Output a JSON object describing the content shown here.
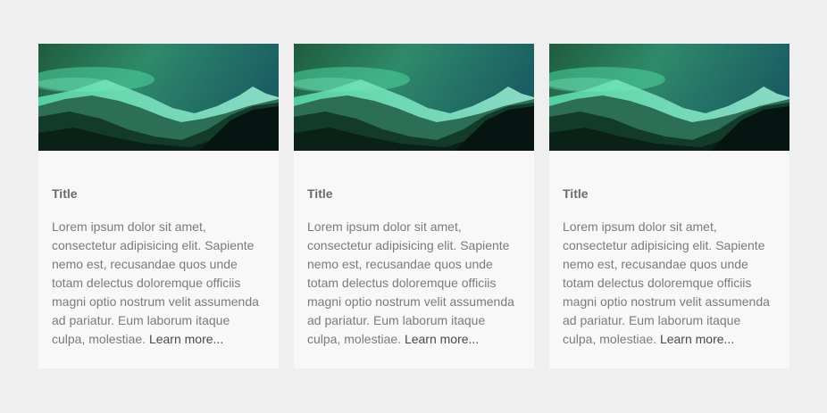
{
  "cards": [
    {
      "image": "mountain-landscape-image",
      "title": "Title",
      "body": "Lorem ipsum dolor sit amet, consectetur adipisicing elit. Sapiente nemo est, recusandae quos unde totam delectus doloremque officiis magni optio nostrum velit assumenda ad pariatur. Eum laborum itaque culpa, molestiae.",
      "link_label": "Learn more..."
    },
    {
      "image": "mountain-landscape-image",
      "title": "Title",
      "body": "Lorem ipsum dolor sit amet, consectetur adipisicing elit. Sapiente nemo est, recusandae quos unde totam delectus doloremque officiis magni optio nostrum velit assumenda ad pariatur. Eum laborum itaque culpa, molestiae.",
      "link_label": "Learn more..."
    },
    {
      "image": "mountain-landscape-image",
      "title": "Title",
      "body": "Lorem ipsum dolor sit amet, consectetur adipisicing elit. Sapiente nemo est, recusandae quos unde totam delectus doloremque officiis magni optio nostrum velit assumenda ad pariatur. Eum laborum itaque culpa, molestiae.",
      "link_label": "Learn more..."
    }
  ],
  "colors": {
    "page_background": "#efefef",
    "card_background": "#f8f8f8",
    "title_color": "#6b6b6b",
    "text_color": "#7b7b7b",
    "link_color": "#4a4a4a"
  }
}
